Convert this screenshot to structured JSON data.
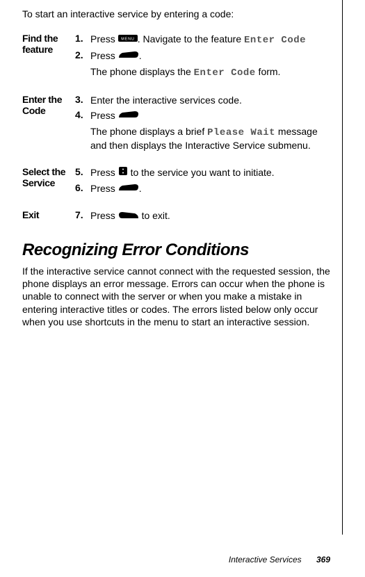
{
  "intro": "To start an interactive service by entering a code:",
  "sections": [
    {
      "label": "Find the feature",
      "steps": [
        {
          "num": "1.",
          "pre": "Press ",
          "icon": "menu",
          "post": ". Navigate to the feature ",
          "code": "Enter Code"
        },
        {
          "num": "2.",
          "pre": "Press ",
          "icon": "soft-right",
          "post": "."
        }
      ],
      "subs": [
        {
          "pre": "The phone displays the ",
          "code": "Enter Code",
          "post": " form."
        }
      ]
    },
    {
      "label": "Enter the Code",
      "steps": [
        {
          "num": "3.",
          "pre": "Enter the interactive services code."
        },
        {
          "num": "4.",
          "pre": "Press ",
          "icon": "soft-right"
        }
      ],
      "subs": [
        {
          "pre": "The phone displays a brief ",
          "code": "Please Wait",
          "post": " message and then displays the Interactive Service submenu."
        }
      ]
    },
    {
      "label": "Select the Service",
      "steps": [
        {
          "num": "5.",
          "pre": "Press ",
          "icon": "scroll",
          "post": " to the service you want to initiate."
        },
        {
          "num": "6.",
          "pre": "Press ",
          "icon": "soft-right",
          "post": "."
        }
      ]
    },
    {
      "label": "Exit",
      "steps": [
        {
          "num": "7.",
          "pre": "Press ",
          "icon": "soft-left",
          "post": " to exit."
        }
      ]
    }
  ],
  "heading": "Recognizing Error Conditions",
  "paragraph": "If the interactive service cannot connect with the requested session, the phone displays an error message. Errors can occur when the phone is unable to connect with the server or when you make a mistake in entering interactive titles or codes. The errors listed below only occur when you use shortcuts in the menu to start an interactive session.",
  "footer_title": "Interactive Services",
  "footer_page": "369"
}
